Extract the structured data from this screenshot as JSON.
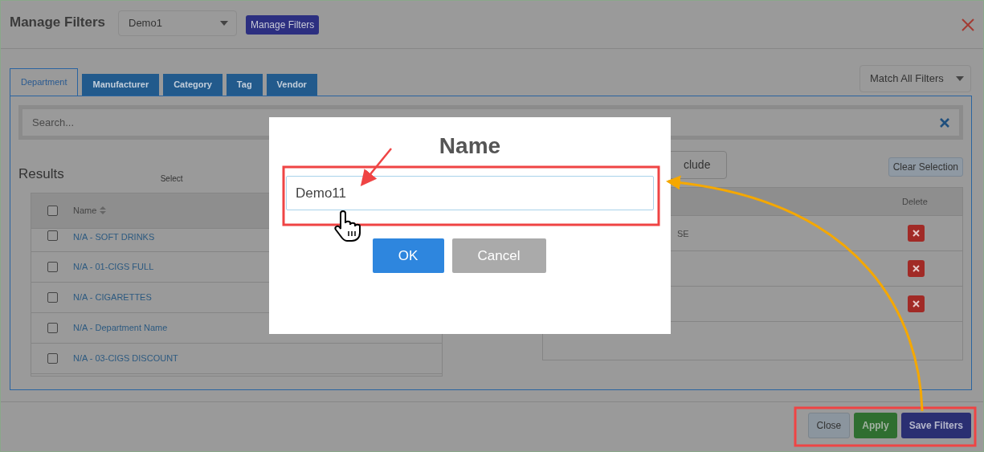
{
  "header": {
    "title": "Manage Filters",
    "filter_select": {
      "value": "Demo1"
    },
    "manage_button": "Manage Filters"
  },
  "tabs": [
    {
      "label": "Department",
      "selected": true
    },
    {
      "label": "Manufacturer",
      "selected": false
    },
    {
      "label": "Category",
      "selected": false
    },
    {
      "label": "Tag",
      "selected": false
    },
    {
      "label": "Vendor",
      "selected": false
    }
  ],
  "match_select": {
    "value": "Match All Filters"
  },
  "search": {
    "placeholder": "Search..."
  },
  "results": {
    "title": "Results",
    "select_text": "Select",
    "select_all_checked": false,
    "columns": [
      "Name"
    ],
    "rows": [
      {
        "name": "N/A - SOFT DRINKS",
        "checked": false
      },
      {
        "name": "N/A - 01-CIGS FULL",
        "checked": false
      },
      {
        "name": "N/A - CIGARETTES",
        "checked": false
      },
      {
        "name": "N/A - Department Name",
        "checked": false
      },
      {
        "name": "N/A - 03-CIGS DISCOUNT",
        "checked": false
      }
    ]
  },
  "selected_panel": {
    "include_button": "clude",
    "clear_button": "Clear Selection",
    "columns": [
      "Delete"
    ],
    "rows": [
      {
        "name": "SE",
        "deletable": true
      },
      {
        "deletable": true
      },
      {
        "deletable": true
      }
    ]
  },
  "footer_buttons": [
    {
      "label": "Close",
      "kind": "close"
    },
    {
      "label": "Apply",
      "kind": "apply"
    },
    {
      "label": "Save Filters",
      "kind": "save"
    }
  ],
  "dialog": {
    "title": "Name",
    "input_value": "Demo11",
    "buttons": [
      {
        "label": "OK",
        "kind": "primary"
      },
      {
        "label": "Cancel",
        "kind": "secondary"
      }
    ]
  }
}
